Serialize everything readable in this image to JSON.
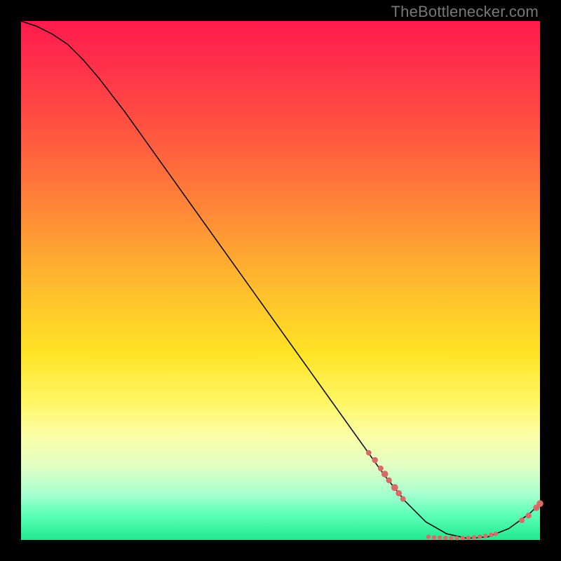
{
  "watermark": "TheBottlenecker.com",
  "colors": {
    "top": "#ff1c4d",
    "mid": "#ffe326",
    "bottom": "#22e88e",
    "curve": "#000000",
    "points": "#d96a6a",
    "page_bg": "#000000"
  },
  "chart_data": {
    "type": "line",
    "title": "",
    "xlabel": "",
    "ylabel": "",
    "xlim": [
      0,
      100
    ],
    "ylim": [
      0,
      100
    ],
    "grid": false,
    "legend": false,
    "series": [
      {
        "name": "curve",
        "style": "line",
        "x": [
          0,
          3,
          6,
          9,
          12,
          15,
          20,
          25,
          30,
          35,
          40,
          45,
          50,
          55,
          60,
          65,
          70,
          74,
          78,
          82,
          86,
          90,
          94,
          98,
          100
        ],
        "y": [
          100,
          99,
          97.5,
          95.5,
          92.5,
          89,
          82.5,
          75.5,
          68.5,
          61.5,
          54.5,
          47.5,
          40.5,
          33.5,
          26.5,
          19.5,
          12.5,
          7.5,
          3.5,
          1.2,
          0.3,
          0.6,
          2.2,
          5.1,
          7
        ]
      },
      {
        "name": "cluster-left",
        "style": "scatter",
        "comment": "salmon dots along the descending part of the curve",
        "x": [
          67,
          68.2,
          69.3,
          70.1,
          70.9,
          72.0,
          72.8,
          73.6
        ],
        "y": [
          16.8,
          15.4,
          13.8,
          12.7,
          11.5,
          10.1,
          9.0,
          7.9
        ],
        "r": [
          3.9,
          4.3,
          4.0,
          4.8,
          4.2,
          5.0,
          4.4,
          4.0
        ]
      },
      {
        "name": "valley-fill",
        "style": "scatter",
        "comment": "tight row of salmon dots along the flat valley bottom",
        "x": [
          78.5,
          79.6,
          80.7,
          81.8,
          82.9,
          84.0,
          85.1,
          86.2,
          87.3,
          88.4,
          89.5,
          90.6,
          91.5
        ],
        "y": [
          0.6,
          0.5,
          0.45,
          0.4,
          0.38,
          0.36,
          0.38,
          0.42,
          0.5,
          0.62,
          0.78,
          0.98,
          1.2
        ],
        "r": [
          3.2,
          3.2,
          3.2,
          3.2,
          3.2,
          3.2,
          3.2,
          3.2,
          3.2,
          3.2,
          3.2,
          3.2,
          3.2
        ]
      },
      {
        "name": "cluster-right",
        "style": "scatter",
        "comment": "pair of salmon dots on the rising tail",
        "x": [
          96.5,
          97.8,
          99.3,
          100
        ],
        "y": [
          3.8,
          4.7,
          6.2,
          7.0
        ],
        "r": [
          4.0,
          4.2,
          4.6,
          4.8
        ]
      }
    ]
  }
}
